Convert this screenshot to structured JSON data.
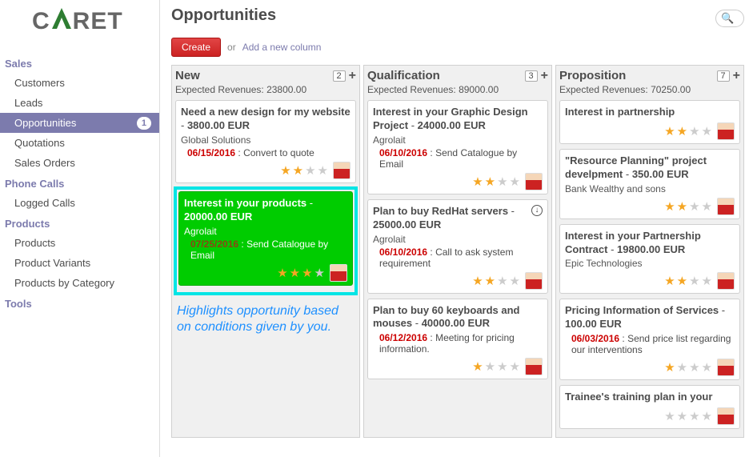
{
  "logo": {
    "pre": "C",
    "mid": "A",
    "post": "RET"
  },
  "page": {
    "title": "Opportunities"
  },
  "search": {
    "placeholder": ""
  },
  "toolbar": {
    "create": "Create",
    "or": "or",
    "addcol": "Add a new column"
  },
  "nav": {
    "sections": [
      {
        "title": "Sales",
        "items": [
          {
            "label": "Customers"
          },
          {
            "label": "Leads"
          },
          {
            "label": "Opportunities",
            "active": true,
            "badge": "1"
          },
          {
            "label": "Quotations"
          },
          {
            "label": "Sales Orders"
          }
        ]
      },
      {
        "title": "Phone Calls",
        "items": [
          {
            "label": "Logged Calls"
          }
        ]
      },
      {
        "title": "Products",
        "items": [
          {
            "label": "Products"
          },
          {
            "label": "Product Variants"
          },
          {
            "label": "Products by Category"
          }
        ]
      },
      {
        "title": "Tools",
        "items": []
      }
    ]
  },
  "annotation": "Highlights opportunity based on conditions given by you.",
  "columns": [
    {
      "title": "New",
      "count": "2",
      "sub": "Expected Revenues: 23800.00",
      "cards": [
        {
          "title": "Need a new design for my website",
          "amount": "3800.00 EUR",
          "company": "Global Solutions",
          "date": "06/15/2016",
          "action": "Convert to quote",
          "stars": 2
        },
        {
          "title": "Interest in your products",
          "amount": "20000.00 EUR",
          "company": "Agrolait",
          "date": "07/25/2016",
          "action": "Send Catalogue by Email",
          "stars": 3,
          "highlighted": true
        }
      ]
    },
    {
      "title": "Qualification",
      "count": "3",
      "sub": "Expected Revenues: 89000.00",
      "cards": [
        {
          "title": "Interest in your Graphic Design Project",
          "amount": "24000.00 EUR",
          "company": "Agrolait",
          "date": "06/10/2016",
          "action": "Send Catalogue by Email",
          "stars": 2
        },
        {
          "title": "Plan to buy RedHat servers",
          "amount": "25000.00 EUR",
          "company": "Agrolait",
          "date": "06/10/2016",
          "action": "Call to ask system requirement",
          "stars": 2,
          "icon": "↓"
        },
        {
          "title": "Plan to buy 60 keyboards and mouses",
          "amount": "40000.00 EUR",
          "company": "",
          "date": "06/12/2016",
          "action": "Meeting for pricing information.",
          "stars": 1
        }
      ]
    },
    {
      "title": "Proposition",
      "count": "7",
      "sub": "Expected Revenues: 70250.00",
      "cards": [
        {
          "title": "Interest in partnership",
          "amount": "",
          "company": "",
          "date": "",
          "action": "",
          "stars": 2
        },
        {
          "title": "\"Resource Planning\" project develpment",
          "amount": "350.00 EUR",
          "company": "Bank Wealthy and sons",
          "date": "",
          "action": "",
          "stars": 2
        },
        {
          "title": "Interest in your Partnership Contract",
          "amount": "19800.00 EUR",
          "company": "Epic Technologies",
          "date": "",
          "action": "",
          "stars": 2
        },
        {
          "title": "Pricing Information of Services",
          "amount": "100.00 EUR",
          "company": "",
          "date": "06/03/2016",
          "action": "Send price list regarding our interventions",
          "stars": 1
        },
        {
          "title": "Trainee's training plan in your",
          "amount": "",
          "company": "",
          "date": "",
          "action": "",
          "stars": 0
        }
      ]
    }
  ]
}
